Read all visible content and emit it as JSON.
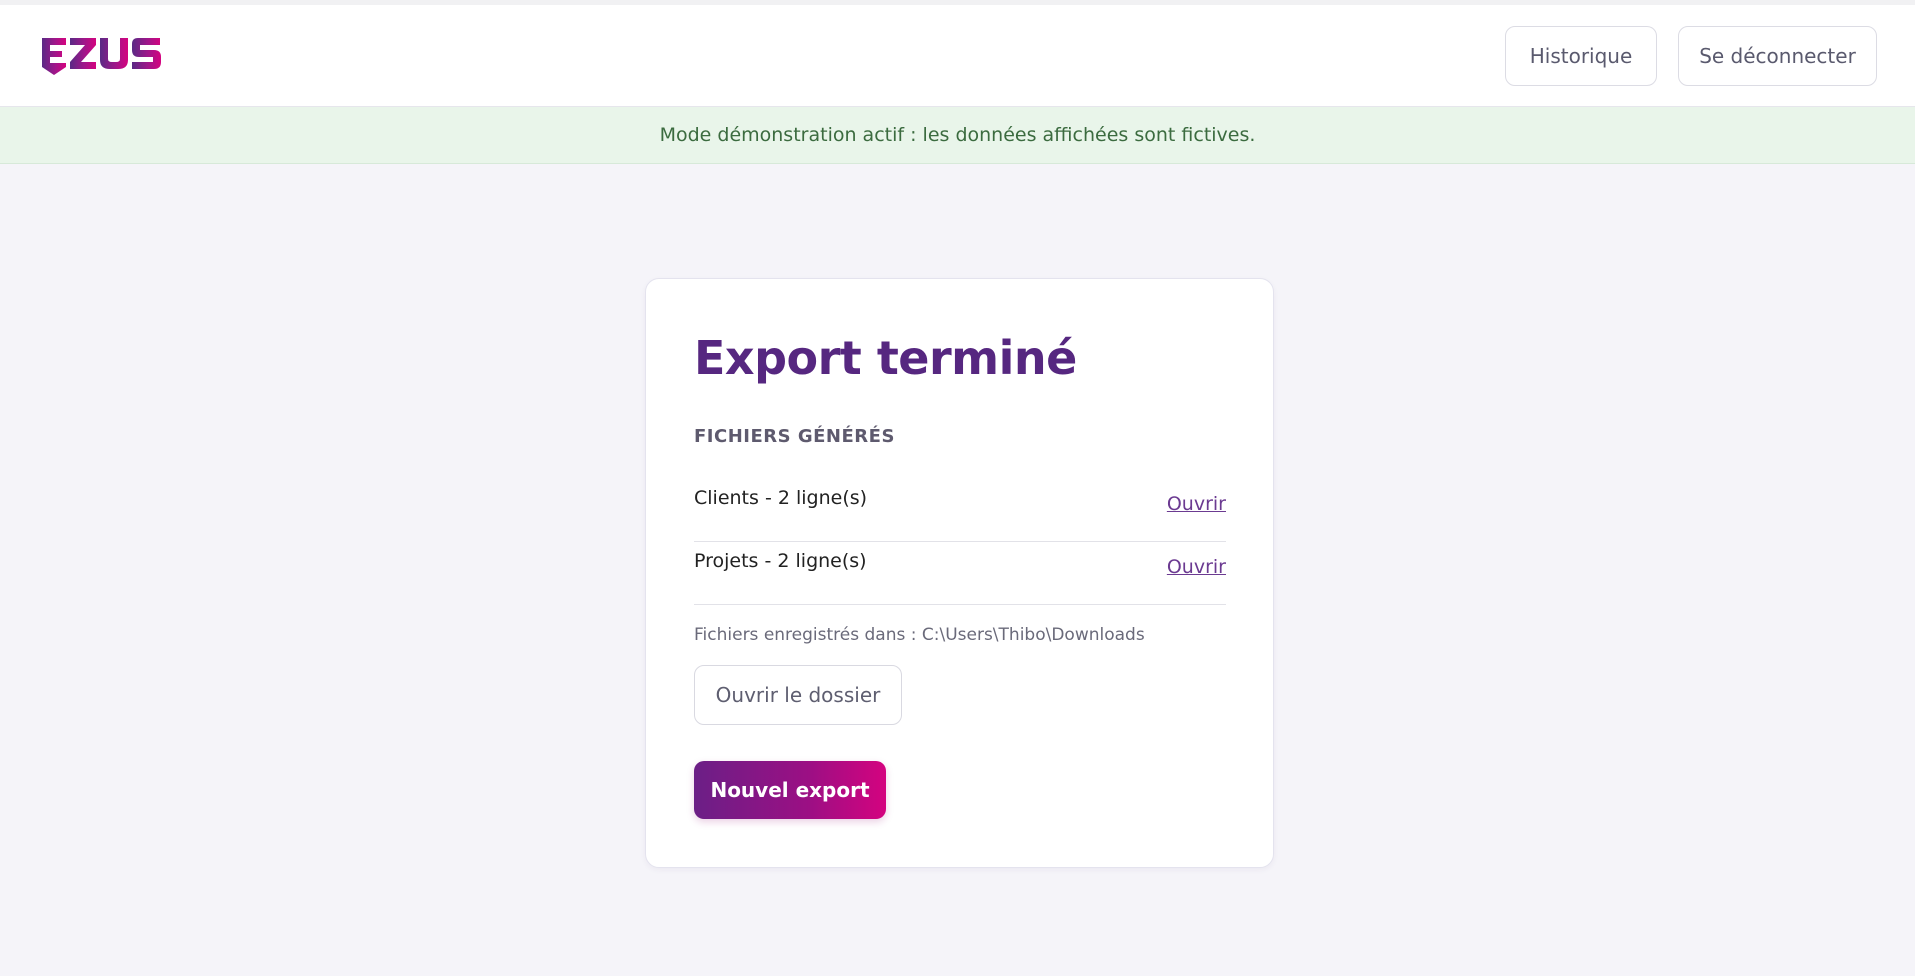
{
  "brand": {
    "logo_text": "EZUS",
    "colors": {
      "primary": "#562780",
      "accent": "#d4037f"
    }
  },
  "header": {
    "history_label": "Historique",
    "logout_label": "Se déconnecter"
  },
  "banner": {
    "text": "Mode démonstration actif : les données affichées sont fictives."
  },
  "export": {
    "title": "Export terminé",
    "files_heading": "FICHIERS GÉNÉRÉS",
    "files": [
      {
        "name": "Clients - 2 ligne(s)",
        "action": "Ouvrir"
      },
      {
        "name": "Projets - 2 ligne(s)",
        "action": "Ouvrir"
      }
    ],
    "saved_in": "Fichiers enregistrés dans : C:\\Users\\Thibo\\Downloads",
    "open_folder_label": "Ouvrir le dossier",
    "new_export_label": "Nouvel export"
  }
}
